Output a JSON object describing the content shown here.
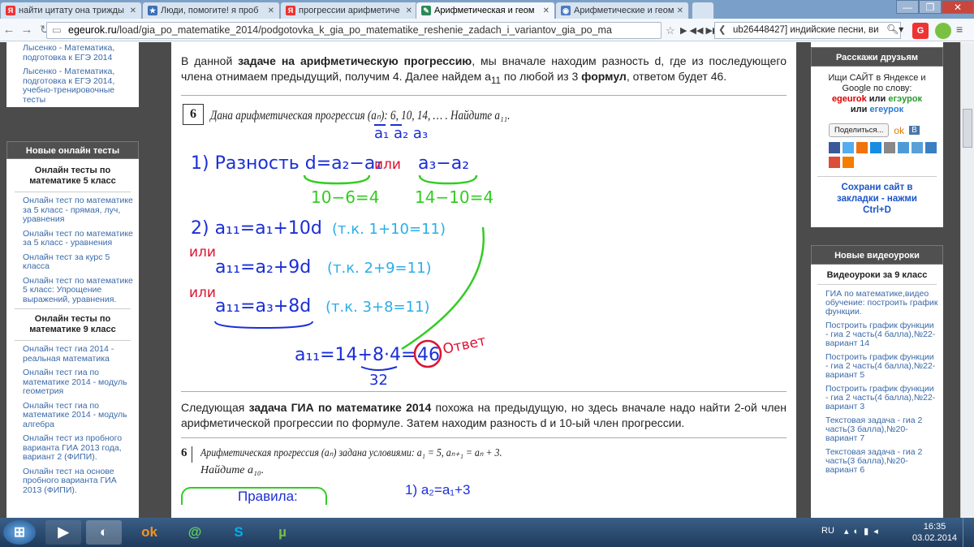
{
  "tabs": [
    {
      "label": "найти цитату она трижды",
      "fav": "Я"
    },
    {
      "label": "Люди, помогите! я проб",
      "fav": "★"
    },
    {
      "label": "прогрессии арифметиче",
      "fav": "Я"
    },
    {
      "label": "Арифметическая и геом",
      "fav": "✎"
    },
    {
      "label": "Арифметические и геом",
      "fav": "◉"
    }
  ],
  "url": {
    "domain": "egeurok.ru",
    "path": "/load/gia_po_matematike_2014/podgotovka_k_gia_po_matematike_reshenie_zadach_i_variantov_gia_po_ma"
  },
  "search": {
    "value": "ub26448427] индийские песни, ви"
  },
  "left": {
    "top_links": [
      "Лысенко - Математика, подготовка к ЕГЭ 2014",
      "Лысенко - Математика, подготовка к ЕГЭ 2014, учебно-тренировочные тесты"
    ],
    "head": "Новые онлайн тесты",
    "sub1": "Онлайн тесты по математике 5 класс",
    "links1": [
      "Онлайн тест по математике за 5 класс - прямая, луч, уравнения",
      "Онлайн тест по математике за 5 класс - уравнения",
      "Онлайн тест за курс 5 класса",
      "Онлайн тест по математике 5 класс: Упрощение выражений, уравнения."
    ],
    "sub2": "Онлайн тесты по математике 9 класс",
    "links2": [
      "Онлайн тест гиа 2014 - реальная математика",
      "Онлайн тест гиа по математике 2014 - модуль геометрия",
      "Онлайн тест гиа по математике 2014 - модуль алгебра",
      "Онлайн тест из пробного варианта ГИА 2013 года, вариант 2 (ФИПИ).",
      "Онлайн тест на основе пробного варианта ГИА 2013 (ФИПИ)."
    ]
  },
  "main": {
    "p1": [
      "В данной ",
      "задаче на арифметическую прогрессию",
      ", мы вначале находим разность d, где из последующего члена отнимаем предыдущий, получим 4. Далее найдем a",
      "11",
      " по любой из 3 ",
      "формул",
      ", ответом будет 46."
    ],
    "task1": "Дана арифметическая прогрессия (aₙ): 6, 10, 14, … . Найдите a₁₁.",
    "num1": "6",
    "hw": {
      "terms": "a₁ a₂ a₃",
      "l1": "1) Разность d=a₂−a₁",
      "ili": "или",
      "l1b": "a₃−a₂",
      "c1": "10−6=4",
      "c2": "14−10=4",
      "l2": "2) a₁₁=a₁+10d",
      "l2n": "(т.к. 1+10=11)",
      "l3": "a₁₁=a₂+9d",
      "l3n": "(т.к. 2+9=11)",
      "l4": "a₁₁=a₃+8d",
      "l4n": "(т.к. 3+8=11)",
      "ans": "a₁₁=14+8·4=",
      "ansv": "46",
      "otvet": "Ответ",
      "under": "32"
    },
    "p2": [
      "Следующая ",
      "задача ГИА по математике 2014",
      " похожа на предыдущую, но здесь вначале надо найти 2-ой член арифметической прогрессии по формуле. Затем находим разность d и 10-ый член прогрессии."
    ],
    "task2": "Арифметическая прогрессия (aₙ) задана условиями: a₁ = 5, aₙ₊₁ = aₙ + 3.",
    "task2b": "Найдите a₁₀.",
    "num2": "6",
    "hw2a": "Правила:",
    "hw2b": "1) a₂=a₁+3"
  },
  "right": {
    "share_head": "Расскажи друзьям",
    "share_text": "Ищи САЙТ в Яндексе и Google по слову:",
    "kw1": "egeurok",
    "kw_or": " или ",
    "kw2": "егэурок",
    "kw_or2": "или ",
    "kw3": "егеурок",
    "share_btn": "Поделиться...",
    "save": "Сохрани сайт в закладки - нажми Ctrl+D",
    "video_head": "Новые видеоуроки",
    "video_sub": "Видеоуроки за 9 класс",
    "video_links": [
      "ГИА по математике,видео обучение: построить график функции.",
      "Построить график функции - гиа 2 часть(4 балла),№22-вариант 14",
      "Построить график функции - гиа 2 часть(4 балла),№22-вариант 5",
      "Построить график функции - гиа 2 часть(4 балла),№22-вариант 3",
      "Текстовая задача - гиа 2 часть(3 балла),№20-вариант 7",
      "Текстовая задача - гиа 2 часть(3 балла),№20-вариант 6"
    ]
  },
  "taskbar": {
    "lang": "RU",
    "time": "16:35",
    "date": "03.02.2014"
  }
}
